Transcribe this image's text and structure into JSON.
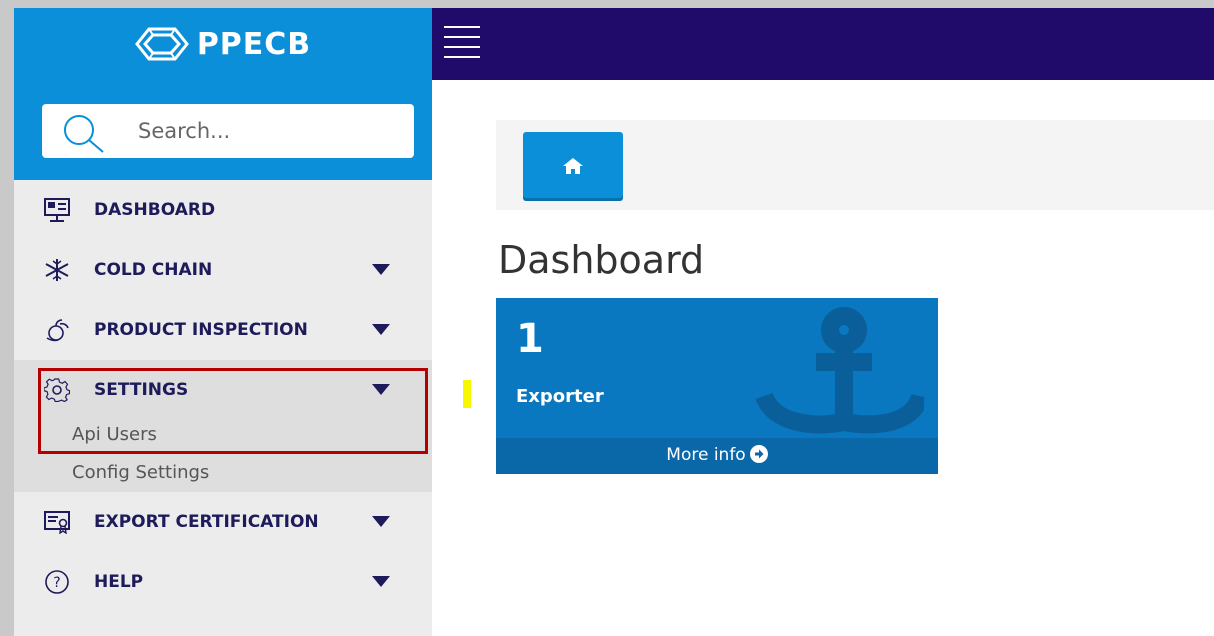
{
  "brand": {
    "name": "PPECB",
    "logo_icon": "ppecb-emblem-icon"
  },
  "search": {
    "placeholder": "Search...",
    "icon": "search-icon"
  },
  "sidebar": {
    "items": [
      {
        "label": "DASHBOARD",
        "icon": "monitor-icon",
        "has_caret": false
      },
      {
        "label": "COLD CHAIN",
        "icon": "snowflake-icon",
        "has_caret": true
      },
      {
        "label": "PRODUCT INSPECTION",
        "icon": "inspection-icon",
        "has_caret": true
      },
      {
        "label": "SETTINGS",
        "icon": "gear-icon",
        "has_caret": true,
        "expanded": true,
        "subitems": [
          {
            "label": "Api Users"
          },
          {
            "label": "Config Settings"
          }
        ]
      },
      {
        "label": "EXPORT CERTIFICATION",
        "icon": "certificate-icon",
        "has_caret": true
      },
      {
        "label": "HELP",
        "icon": "help-icon",
        "has_caret": true
      }
    ]
  },
  "topbar": {
    "menu_icon": "hamburger-icon"
  },
  "breadcrumb": {
    "home_icon": "home-icon"
  },
  "main": {
    "title": "Dashboard",
    "cards": [
      {
        "number": "1",
        "label": "Exporter",
        "link": "More info",
        "icon": "anchor-icon",
        "link_icon": "arrow-circle-right-icon"
      }
    ]
  },
  "colors": {
    "brand_blue": "#0a8fd8",
    "topbar_purple": "#200a6a",
    "nav_text": "#1e1b5a",
    "card_blue": "#0a78c0",
    "highlight_red": "#b30000"
  }
}
